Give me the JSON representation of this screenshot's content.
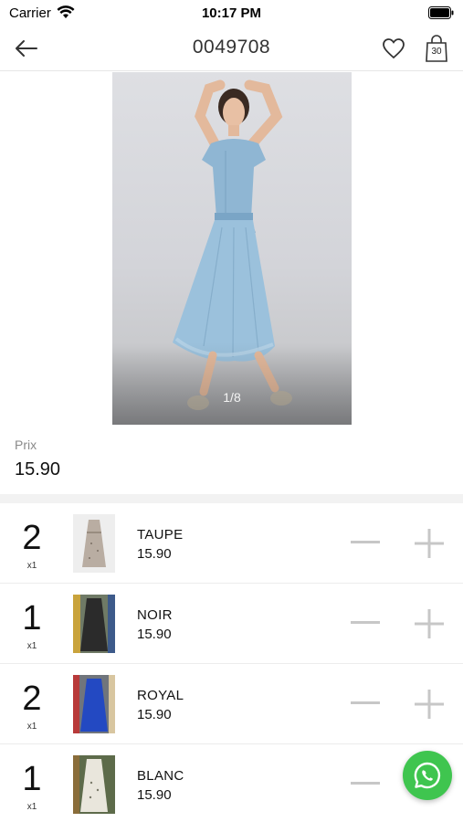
{
  "status_bar": {
    "carrier": "Carrier",
    "time": "10:17 PM"
  },
  "nav": {
    "title": "0049708",
    "cart_count": "30"
  },
  "gallery": {
    "page_indicator": "1/8"
  },
  "price": {
    "label": "Prix",
    "value": "15.90"
  },
  "variants": [
    {
      "qty": "2",
      "multiplier": "x1",
      "color_name": "TAUPE",
      "price": "15.90",
      "thumb_colors": [
        "#c8bfb6",
        "#a89a8d"
      ]
    },
    {
      "qty": "1",
      "multiplier": "x1",
      "color_name": "NOIR",
      "price": "15.90",
      "thumb_colors": [
        "#2a2a2a",
        "#6b7b5a"
      ]
    },
    {
      "qty": "2",
      "multiplier": "x1",
      "color_name": "ROYAL",
      "price": "15.90",
      "thumb_colors": [
        "#2246b8",
        "#6a6f78"
      ]
    },
    {
      "qty": "1",
      "multiplier": "x1",
      "color_name": "BLANC",
      "price": "15.90",
      "thumb_colors": [
        "#e9e6dc",
        "#5d6b4a"
      ]
    }
  ],
  "colors": {
    "whatsapp": "#3fc54f",
    "divider": "#f2f2f2",
    "control_gray": "#c7c7c7"
  },
  "icons": {
    "back": "arrow-left-icon",
    "favorite": "heart-icon",
    "cart": "shopping-bag-icon",
    "minus": "minus-icon",
    "plus": "plus-icon",
    "chat": "whatsapp-icon"
  }
}
